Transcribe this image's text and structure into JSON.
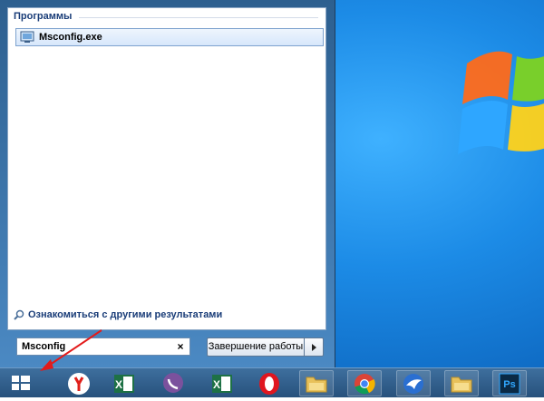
{
  "start_menu": {
    "section_title": "Программы",
    "results": [
      {
        "label": "Msconfig.exe",
        "icon": "msconfig-icon"
      }
    ],
    "see_more_label": "Ознакомиться с другими результатами",
    "search": {
      "value": "Msconfig",
      "clear_label": "×"
    },
    "shutdown_label": "Завершение работы"
  },
  "taskbar": {
    "items": [
      {
        "name": "yandex-browser-icon"
      },
      {
        "name": "excel-icon"
      },
      {
        "name": "viber-icon"
      },
      {
        "name": "excel-icon"
      },
      {
        "name": "opera-icon"
      },
      {
        "name": "folder-icon"
      },
      {
        "name": "chrome-icon"
      },
      {
        "name": "bird-app-icon"
      },
      {
        "name": "folder-icon"
      },
      {
        "name": "photoshop-icon"
      }
    ],
    "photoshop_text": "Ps",
    "excel_text": "X"
  },
  "colors": {
    "accent": "#1a3d78",
    "desktop_blue": "#1c8be6",
    "taskbar": "#27517c",
    "arrow": "#e31b1b"
  }
}
